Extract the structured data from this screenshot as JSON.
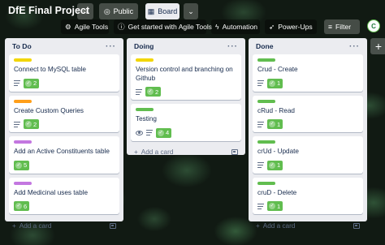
{
  "header": {
    "board_title": "DfE Final Project",
    "visibility_label": "Public",
    "view_label": "Board"
  },
  "toolbar": {
    "agile_tools": "Agile Tools",
    "get_started": "Get started with Agile Tools",
    "automation": "Automation",
    "power_ups": "Power-Ups",
    "filter": "Filter",
    "avatar_initials": "C"
  },
  "colors": {
    "label_yellow": "#f2d600",
    "label_orange": "#ff9f1a",
    "label_purple": "#c377e0",
    "label_green": "#61bd4f",
    "badge_green": "#61bd4f"
  },
  "lists": [
    {
      "name": "To Do",
      "add_card": "Add a card",
      "cards": [
        {
          "label_color": "yellow",
          "title": "Connect to MySQL table",
          "has_description": true,
          "watching": false,
          "checklist": "2"
        },
        {
          "label_color": "orange",
          "title": "Create Custom Queries",
          "has_description": true,
          "watching": false,
          "checklist": "2"
        },
        {
          "label_color": "purple",
          "title": "Add an Active Constituents table",
          "has_description": false,
          "watching": false,
          "checklist": "5"
        },
        {
          "label_color": "purple",
          "title": "Add Medicinal uses table",
          "has_description": false,
          "watching": false,
          "checklist": "6"
        }
      ]
    },
    {
      "name": "Doing",
      "add_card": "Add a card",
      "cards": [
        {
          "label_color": "yellow",
          "title": "Version control and branching on Github",
          "has_description": true,
          "watching": false,
          "checklist": "2"
        },
        {
          "label_color": "green",
          "title": "Testing",
          "has_description": true,
          "watching": true,
          "checklist": "4"
        }
      ]
    },
    {
      "name": "Done",
      "add_card": "Add a card",
      "cards": [
        {
          "label_color": "green",
          "title": "Crud - Create",
          "has_description": true,
          "watching": false,
          "checklist": "1"
        },
        {
          "label_color": "green",
          "title": "cRud - Read",
          "has_description": true,
          "watching": false,
          "checklist": "1"
        },
        {
          "label_color": "green",
          "title": "crUd - Update",
          "has_description": true,
          "watching": false,
          "checklist": "1"
        },
        {
          "label_color": "green",
          "title": "cruD - Delete",
          "has_description": true,
          "watching": false,
          "checklist": "1"
        }
      ]
    }
  ],
  "list_menu_glyph": "···",
  "add_glyph": "+"
}
